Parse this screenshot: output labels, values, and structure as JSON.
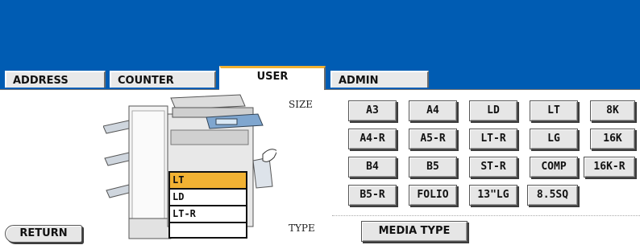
{
  "tabs": {
    "address": "ADDRESS",
    "counter": "COUNTER",
    "user": "USER",
    "admin": "ADMIN"
  },
  "labels": {
    "size": "SIZE",
    "type": "TYPE"
  },
  "size_buttons": {
    "a3": "A3",
    "a4": "A4",
    "ld": "LD",
    "lt": "LT",
    "k8": "8K",
    "a4r": "A4-R",
    "a5r": "A5-R",
    "ltr": "LT-R",
    "lg": "LG",
    "k16": "16K",
    "b4": "B4",
    "b5": "B5",
    "str": "ST-R",
    "comp": "COMP",
    "k16r": "16K-R",
    "b5r": "B5-R",
    "folio": "FOLIO",
    "lg13": "13\"LG",
    "sq85": "8.5SQ"
  },
  "media_type": "MEDIA TYPE",
  "return": "RETURN",
  "paper_list": {
    "items": [
      "LT",
      "LD",
      "LT-R",
      ""
    ],
    "selected": "LT"
  },
  "colors": {
    "header": "#005cb3",
    "active_tab_accent": "#f2b233",
    "selected_paper": "#f2b233"
  }
}
